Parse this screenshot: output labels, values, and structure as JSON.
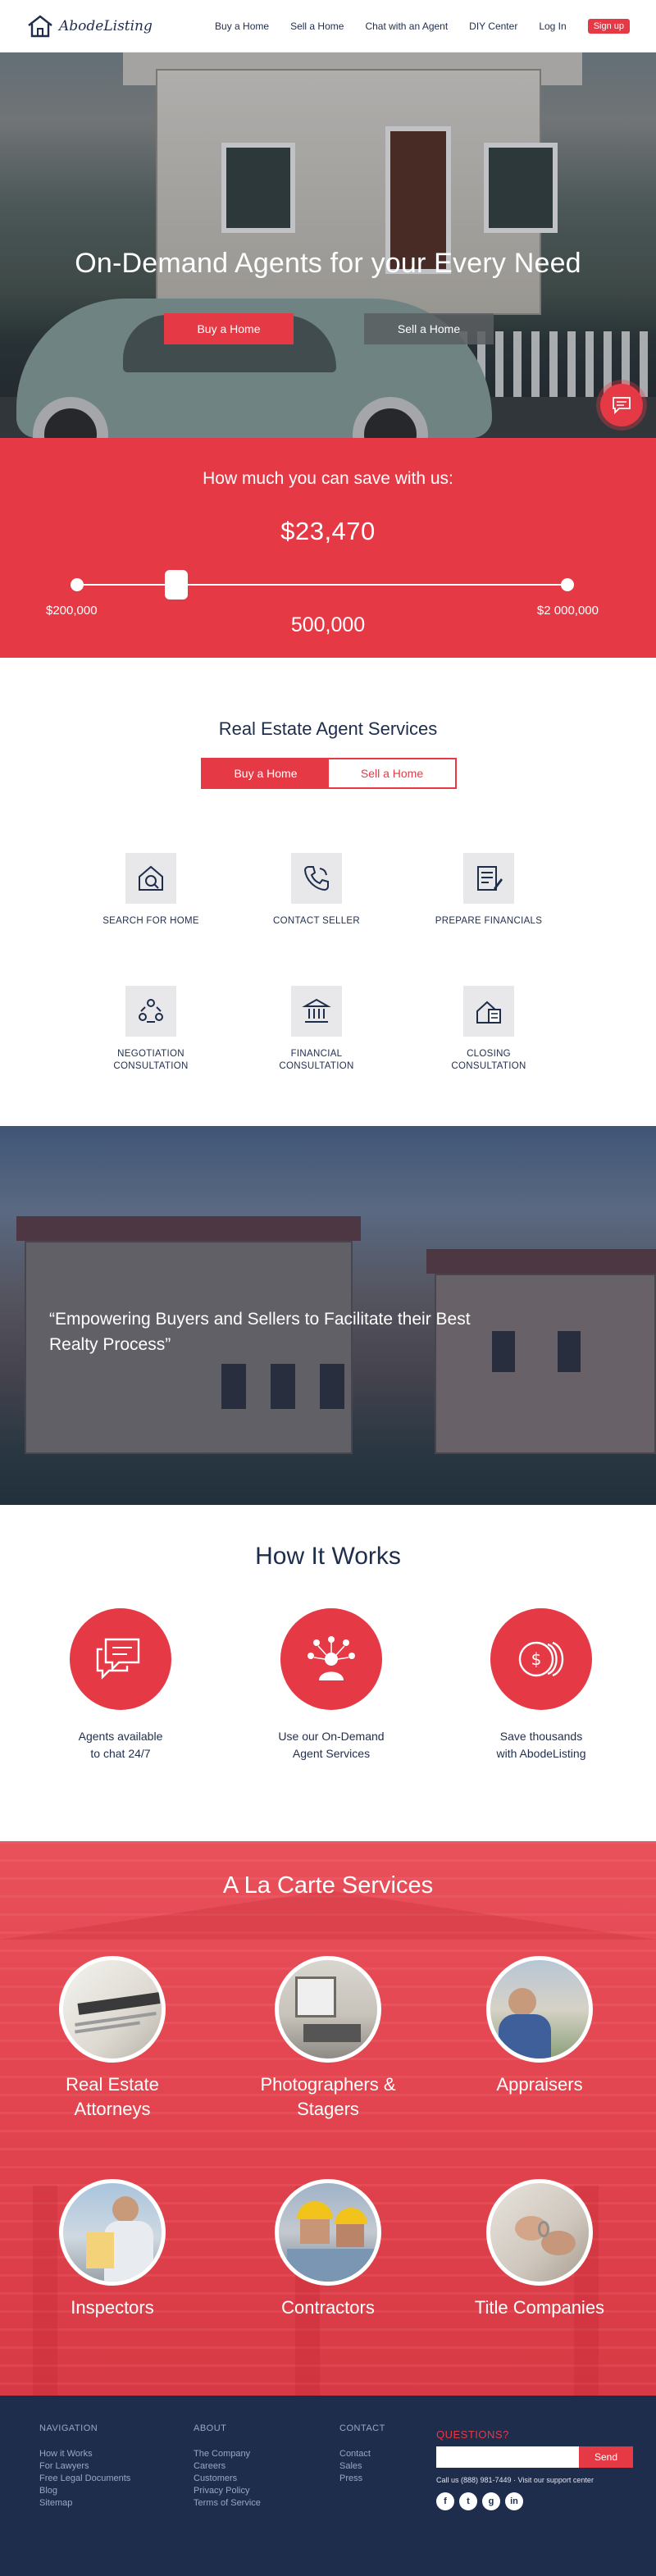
{
  "brand": {
    "name": "AbodeListing"
  },
  "nav": {
    "links": [
      "Buy a Home",
      "Sell a Home",
      "Chat with an Agent",
      "DIY Center",
      "Log In"
    ],
    "signup": "Sign up"
  },
  "hero": {
    "title": "On-Demand Agents for your Every Need",
    "buy_button": "Buy a Home",
    "sell_button": "Sell a Home"
  },
  "savings": {
    "question": "How much you can save with us:",
    "amount": "$23,470",
    "min_label": "$200,000",
    "max_label": "$2 000,000",
    "selected_value": "500,000",
    "slider_fraction": 0.16
  },
  "services": {
    "title": "Real Estate Agent Services",
    "toggle_buy": "Buy a Home",
    "toggle_sell": "Sell a Home",
    "items": [
      {
        "label": "SEARCH FOR HOME",
        "icon": "house-search-icon"
      },
      {
        "label": "CONTACT SELLER",
        "icon": "phone-icon"
      },
      {
        "label": "PREPARE FINANCIALS",
        "icon": "document-pen-icon"
      },
      {
        "label": "NEGOTIATION\nCONSULTATION",
        "icon": "people-network-icon"
      },
      {
        "label": "FINANCIAL\nCONSULTATION",
        "icon": "bank-icon"
      },
      {
        "label": "CLOSING\nCONSULTATION",
        "icon": "house-document-icon"
      }
    ]
  },
  "quote": {
    "text": "“Empowering Buyers and Sellers to Facilitate their Best Realty Process”"
  },
  "how_it_works": {
    "title": "How It Works",
    "steps": [
      {
        "label": "Agents available\nto chat 24/7",
        "icon": "chat-bubbles-icon"
      },
      {
        "label": "Use our On-Demand\nAgent Services",
        "icon": "agent-network-icon"
      },
      {
        "label": "Save thousands\nwith AbodeListing",
        "icon": "coins-icon"
      }
    ]
  },
  "a_la_carte": {
    "title": "A La Carte Services",
    "items": [
      {
        "label": "Real Estate\nAttorneys"
      },
      {
        "label": "Photographers &\nStagers"
      },
      {
        "label": "Appraisers"
      },
      {
        "label": "Inspectors"
      },
      {
        "label": "Contractors"
      },
      {
        "label": "Title Companies"
      }
    ]
  },
  "footer": {
    "navigation": {
      "title": "NAVIGATION",
      "links": [
        "How it Works",
        "For Lawyers",
        "Free Legal Documents",
        "Blog",
        "Sitemap"
      ]
    },
    "about": {
      "title": "ABOUT",
      "links": [
        "The Company",
        "Careers",
        "Customers",
        "Privacy Policy",
        "Terms of Service"
      ]
    },
    "contact": {
      "title": "CONTACT",
      "links": [
        "Contact",
        "Sales",
        "Press"
      ]
    },
    "questions": "QUESTIONS?",
    "send": "Send",
    "call": "Call us (888) 981-7449 · Visit our support center",
    "social": [
      "f",
      "t",
      "g",
      "in"
    ]
  },
  "colors": {
    "accent": "#e63946",
    "navy": "#1f2d4d"
  }
}
